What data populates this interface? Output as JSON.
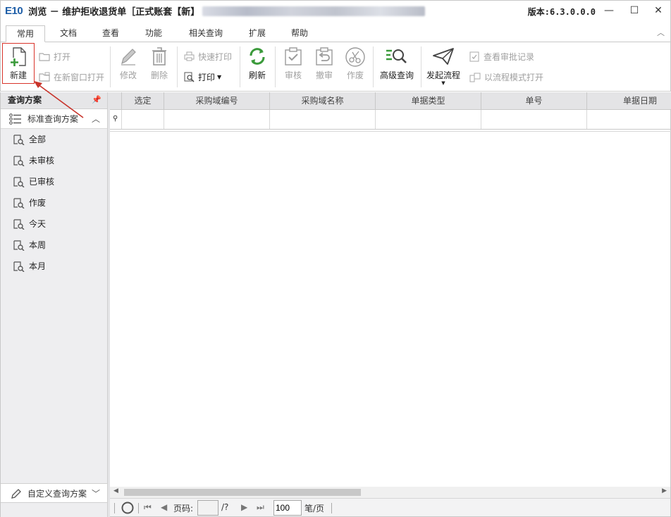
{
  "window": {
    "logo": "E10",
    "title": "浏览 － 维护拒收退货单［正式账套【新】",
    "version": "版本:6.3.0.0.0",
    "min": "—",
    "max": "☐",
    "close": "✕"
  },
  "tabs": [
    "常用",
    "文档",
    "查看",
    "功能",
    "相关查询",
    "扩展",
    "帮助"
  ],
  "ribbon": {
    "new": "新建",
    "open": "打开",
    "open_new_window": "在新窗口打开",
    "edit": "修改",
    "delete": "删除",
    "quick_print": "快速打印",
    "print": "打印",
    "refresh": "刷新",
    "approve": "审核",
    "unapprove": "撤审",
    "void": "作废",
    "advanced_query": "高级查询",
    "start_flow": "发起流程",
    "view_approval": "查看审批记录",
    "open_flow_mode": "以流程模式打开"
  },
  "left_panel": {
    "header": "查询方案",
    "pin": "ᵖ",
    "standard_group": "标准查询方案",
    "items": [
      "全部",
      "未审核",
      "已审核",
      "作废",
      "今天",
      "本周",
      "本月"
    ],
    "custom_group": "自定义查询方案"
  },
  "grid": {
    "columns": [
      "选定",
      "采购域编号",
      "采购域名称",
      "单据类型",
      "单号",
      "单据日期"
    ],
    "rows": []
  },
  "pager": {
    "page_label": "页码:",
    "page_value": "",
    "total": "/?",
    "page_size": "100",
    "per_page_label": "笔/页"
  },
  "colors": {
    "accent": "#3a9a3a",
    "highlight": "#d9342b",
    "logo": "#1f5fa8"
  }
}
